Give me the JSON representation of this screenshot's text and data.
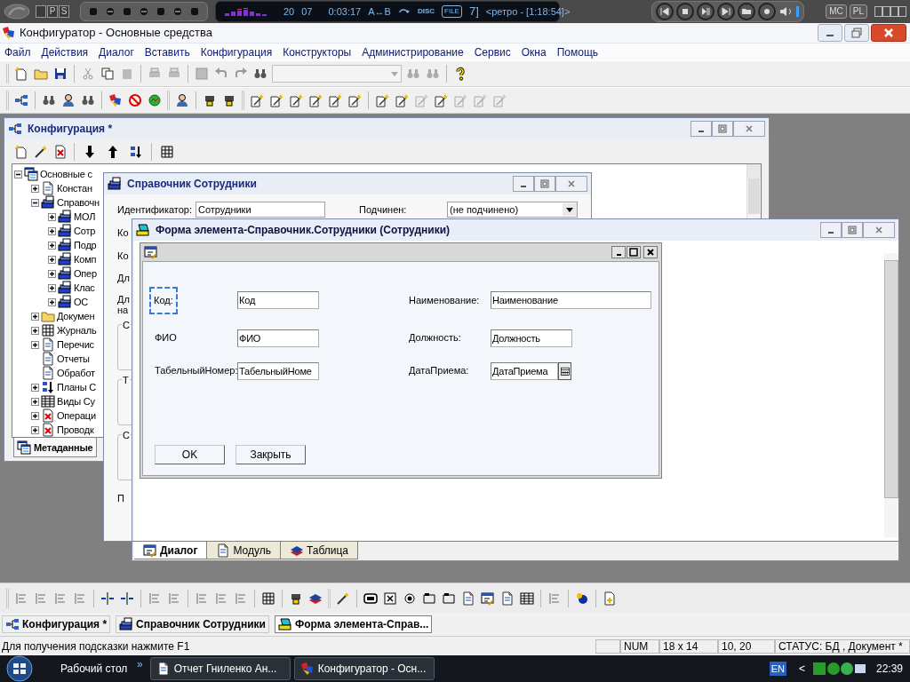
{
  "player": {
    "mode_buttons": [
      "P",
      "S"
    ],
    "display": {
      "track": "20",
      "index": "07",
      "time": "0:03:17",
      "ab": "A↔B",
      "disc": "DISC",
      "file": "FILE",
      "number": "7]",
      "title": "<ретро - [1:18:54]>"
    },
    "side_buttons": [
      "MC",
      "PL"
    ]
  },
  "app": {
    "title": "Конфигуратор - Основные средства"
  },
  "menu": [
    "Файл",
    "Действия",
    "Диалог",
    "Вставить",
    "Конфигурация",
    "Конструкторы",
    "Администрирование",
    "Сервис",
    "Окна",
    "Помощь"
  ],
  "config_window": {
    "title": "Конфигурация *",
    "tree": [
      {
        "label": "Основные с",
        "expandable": true,
        "expanded": true,
        "children": [
          {
            "label": "Констан",
            "expandable": true,
            "expanded": false
          },
          {
            "label": "Справочн",
            "expandable": true,
            "expanded": true,
            "children": [
              {
                "label": "МОЛ",
                "expandable": true,
                "expanded": false
              },
              {
                "label": "Сотр",
                "expandable": true,
                "expanded": false
              },
              {
                "label": "Подр",
                "expandable": true,
                "expanded": false
              },
              {
                "label": "Комп",
                "expandable": true,
                "expanded": false
              },
              {
                "label": "Опер",
                "expandable": true,
                "expanded": false
              },
              {
                "label": "Клас",
                "expandable": true,
                "expanded": false
              },
              {
                "label": "ОС",
                "expandable": true,
                "expanded": false
              }
            ]
          },
          {
            "label": "Докумен",
            "expandable": true,
            "expanded": false
          },
          {
            "label": "Журналь",
            "expandable": true,
            "expanded": false
          },
          {
            "label": "Перечис",
            "expandable": true,
            "expanded": false
          },
          {
            "label": "Отчеты",
            "expandable": false
          },
          {
            "label": "Обработ",
            "expandable": false
          },
          {
            "label": "Планы С",
            "expandable": true,
            "expanded": false
          },
          {
            "label": "Виды Су",
            "expandable": true,
            "expanded": false
          },
          {
            "label": "Операци",
            "expandable": true,
            "expanded": false
          },
          {
            "label": "Проводк",
            "expandable": true,
            "expanded": false
          }
        ]
      }
    ],
    "tab": "Метаданные"
  },
  "catalog_window": {
    "title": "Справочник Сотрудники",
    "identifier_label": "Идентификатор:",
    "identifier_value": "Сотрудники",
    "parent_label": "Подчинен:",
    "parent_value": "(не подчинено)",
    "clipped_labels": [
      "Ко",
      "Ко",
      "Дл",
      "Дл",
      "на"
    ],
    "group_labels": [
      "С",
      "Т",
      "С"
    ],
    "bottom_label": "П"
  },
  "form_window": {
    "title": "Форма элемента-Справочник.Сотрудники (Сотрудники)",
    "fields": [
      {
        "label": "Код:",
        "value": "Код",
        "kind": "text",
        "selected": true
      },
      {
        "label": "Наименование:",
        "value": "Наименование",
        "kind": "wide",
        "selected": false
      },
      {
        "label": "ФИО",
        "value": "ФИО",
        "kind": "text",
        "selected": false
      },
      {
        "label": "Должность:",
        "value": "Должность",
        "kind": "text",
        "selected": false
      },
      {
        "label": "ТабельныйНомер:",
        "value": "ТабельныйНоме",
        "kind": "text",
        "selected": false
      },
      {
        "label": "ДатаПриема:",
        "value": "ДатаПриема",
        "kind": "date",
        "selected": false
      }
    ],
    "buttons": [
      "OK",
      "Закрыть"
    ],
    "tabs": [
      {
        "label": "Диалог",
        "selected": true
      },
      {
        "label": "Модуль",
        "selected": false
      },
      {
        "label": "Таблица",
        "selected": false
      }
    ]
  },
  "mdi_tabs": [
    {
      "label": "Конфигурация *",
      "selected": false
    },
    {
      "label": "Справочник Сотрудники",
      "selected": false
    },
    {
      "label": "Форма элемента-Справ...",
      "selected": true
    }
  ],
  "status_bar": {
    "hint": "Для получения подсказки нажмите F1",
    "num": "NUM",
    "size": "18 x 14",
    "position": "10, 20",
    "status": "СТАТУС: БД , Документ *"
  },
  "taskbar": {
    "desktop": "Рабочий стол",
    "more": "»",
    "buttons": [
      "Отчет Гниленко Ан...",
      "Конфигуратор - Осн..."
    ],
    "language": "EN",
    "chevron": "<",
    "clock": "22:39"
  }
}
